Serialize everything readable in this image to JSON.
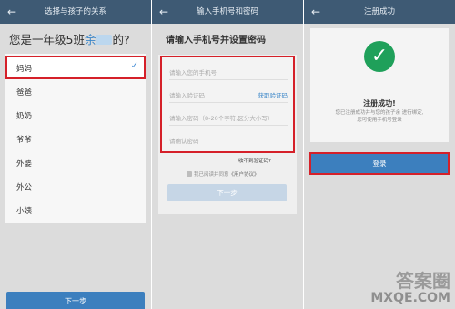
{
  "screen1": {
    "title": "选择与孩子的关系",
    "question_prefix": "您是一年级5班",
    "question_name": "余",
    "question_suffix": "的?",
    "relations": [
      "妈妈",
      "爸爸",
      "奶奶",
      "爷爷",
      "外婆",
      "外公",
      "小姨"
    ],
    "selected": "妈妈",
    "next_label": "下一步"
  },
  "screen2": {
    "title": "输入手机号和密码",
    "heading": "请输入手机号并设置密码",
    "fields": [
      {
        "placeholder": "请输入您的手机号"
      },
      {
        "placeholder": "请输入验证码",
        "action": "获取验证码"
      },
      {
        "placeholder": "请输入密码（8-20个字符,区分大小写）"
      },
      {
        "placeholder": "请确认密码"
      }
    ],
    "hint": "收不到验证码?",
    "agree_text": "我已阅读并同意",
    "agree_link": "《用户协议》",
    "next_label": "下一步"
  },
  "screen3": {
    "title": "注册成功",
    "success_title": "注册成功!",
    "success_text": "您已注册成功并与您的孩子余   进行绑定,\n您可使用手机号登录",
    "login_label": "登录"
  },
  "watermark": {
    "big": "答案圈",
    "small": "MXQE.COM"
  },
  "colors": {
    "topbar": "#3e5a74",
    "accent": "#3c7fbe",
    "highlight": "#d52029",
    "success": "#1fa05a"
  }
}
